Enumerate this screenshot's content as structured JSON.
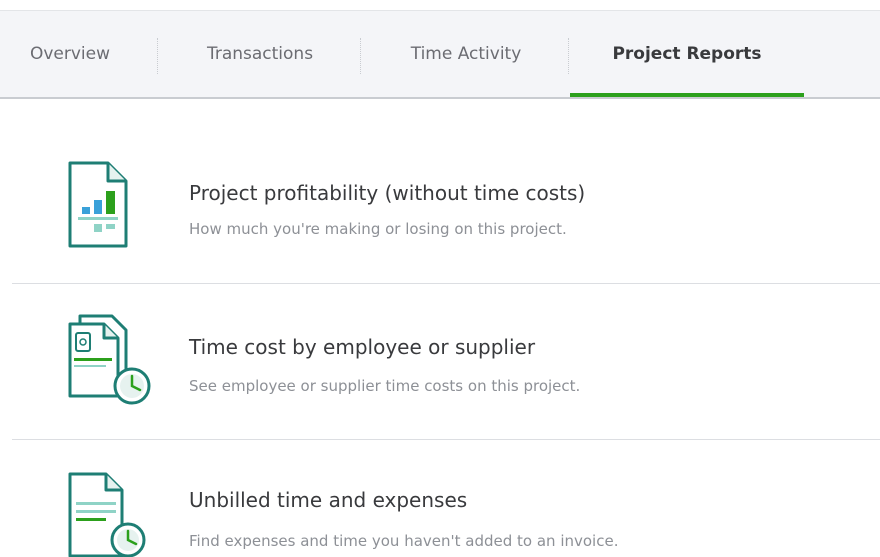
{
  "tabs": [
    {
      "label": "Overview",
      "active": false
    },
    {
      "label": "Transactions",
      "active": false
    },
    {
      "label": "Time Activity",
      "active": false
    },
    {
      "label": "Project Reports",
      "active": true
    }
  ],
  "colors": {
    "accent_green": "#2ca01c",
    "icon_teal": "#1e7e74",
    "title_text": "#393a3d",
    "desc_text": "#8d9096"
  },
  "reports": [
    {
      "title": "Project profitability (without time costs)",
      "description": "How much you're making or losing on this project.",
      "icon": "bar-chart-document-icon"
    },
    {
      "title": "Time cost by employee or supplier",
      "description": "See employee or supplier time costs on this project.",
      "icon": "documents-clock-icon"
    },
    {
      "title": "Unbilled time and expenses",
      "description": "Find expenses and time you haven't added to an invoice.",
      "icon": "document-clock-icon"
    }
  ]
}
